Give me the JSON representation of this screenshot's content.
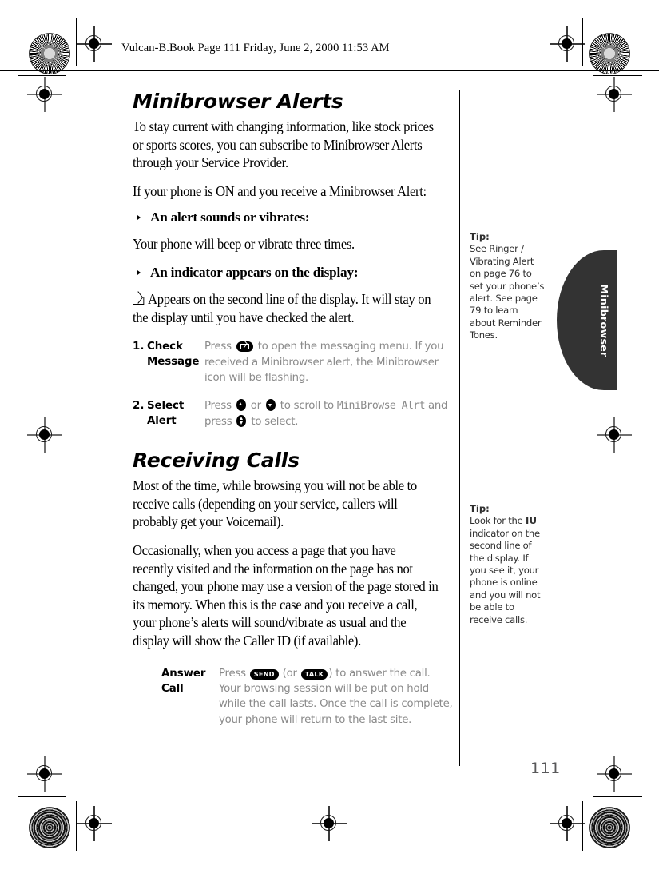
{
  "page": {
    "running_head": "Vulcan-B.Book  Page 111  Friday, June 2, 2000  11:53 AM",
    "folio": "111",
    "thumb_tab": "Minibrowser"
  },
  "sections": [
    {
      "heading": "Minibrowser Alerts",
      "paragraphs": [
        "To stay current with changing information, like stock prices or sports scores, you can subscribe to Minibrowser Alerts through your Service Provider.",
        "If your phone is ON and you receive a Minibrowser Alert:"
      ],
      "bullets": [
        {
          "label": "An alert sounds or vibrates:",
          "follow": "Your phone will beep or vibrate three times."
        },
        {
          "label": "An indicator appears on the display:",
          "follow": "Appears on the second line of the display. It will stay on the display until you have checked the alert.",
          "follow_icon": "envelope-icon"
        }
      ],
      "steps": [
        {
          "number": "1.",
          "term": "Check Message",
          "body_pre": "Press",
          "body_icon": "envelope-key-icon",
          "body_post": "to open the messaging menu. If you received a Minibrowser alert, the Minibrowser icon will be flashing."
        },
        {
          "number": "2.",
          "term": "Select Alert",
          "press_label": "Press",
          "up_icon": "up-arrow-key-icon",
          "or_label": "or",
          "down_icon": "down-arrow-key-icon",
          "scroll_label": "to scroll to",
          "lcd_text": "MiniBrowse Alrt",
          "and_press_label": "and press",
          "select_icon": "select-key-icon",
          "select_label": "to select."
        }
      ]
    },
    {
      "heading": "Receiving Calls",
      "paragraphs": [
        "Most of the time, while browsing you will not be able to receive calls (depending on your service, callers will probably get your Voicemail).",
        "Occasionally, when you access a page that you have recently visited and the information on the page has not changed, your phone may use a version of the page stored in its memory. When this is the case and you receive a call, your phone’s alerts will sound/vibrate as usual and the display will show the Caller ID (if available)."
      ],
      "steps": [
        {
          "term": "Answer Call",
          "press_label": "Press",
          "send_key": "SEND",
          "or_open": "(or",
          "talk_key": "TALK",
          "or_close": ")",
          "body_post": "to answer the call. Your browsing session will be put on hold while the call lasts. Once the call is complete, your phone will return to the last site."
        }
      ]
    }
  ],
  "tips": [
    {
      "label": "Tip:",
      "text": "See Ringer / Vibrating Alert on page 76 to set your phone’s alert. See page 79 to learn about Reminder Tones."
    },
    {
      "label": "Tip:",
      "text_before": "Look for the",
      "indicator": "IU",
      "text_after": "indicator on the second line of the display. If you see it, your phone is online and you will not be able to receive calls."
    }
  ],
  "colors": {
    "tab_background": "#333333",
    "step_body_text": "#8a8a8a",
    "folio_text": "#58585a"
  }
}
